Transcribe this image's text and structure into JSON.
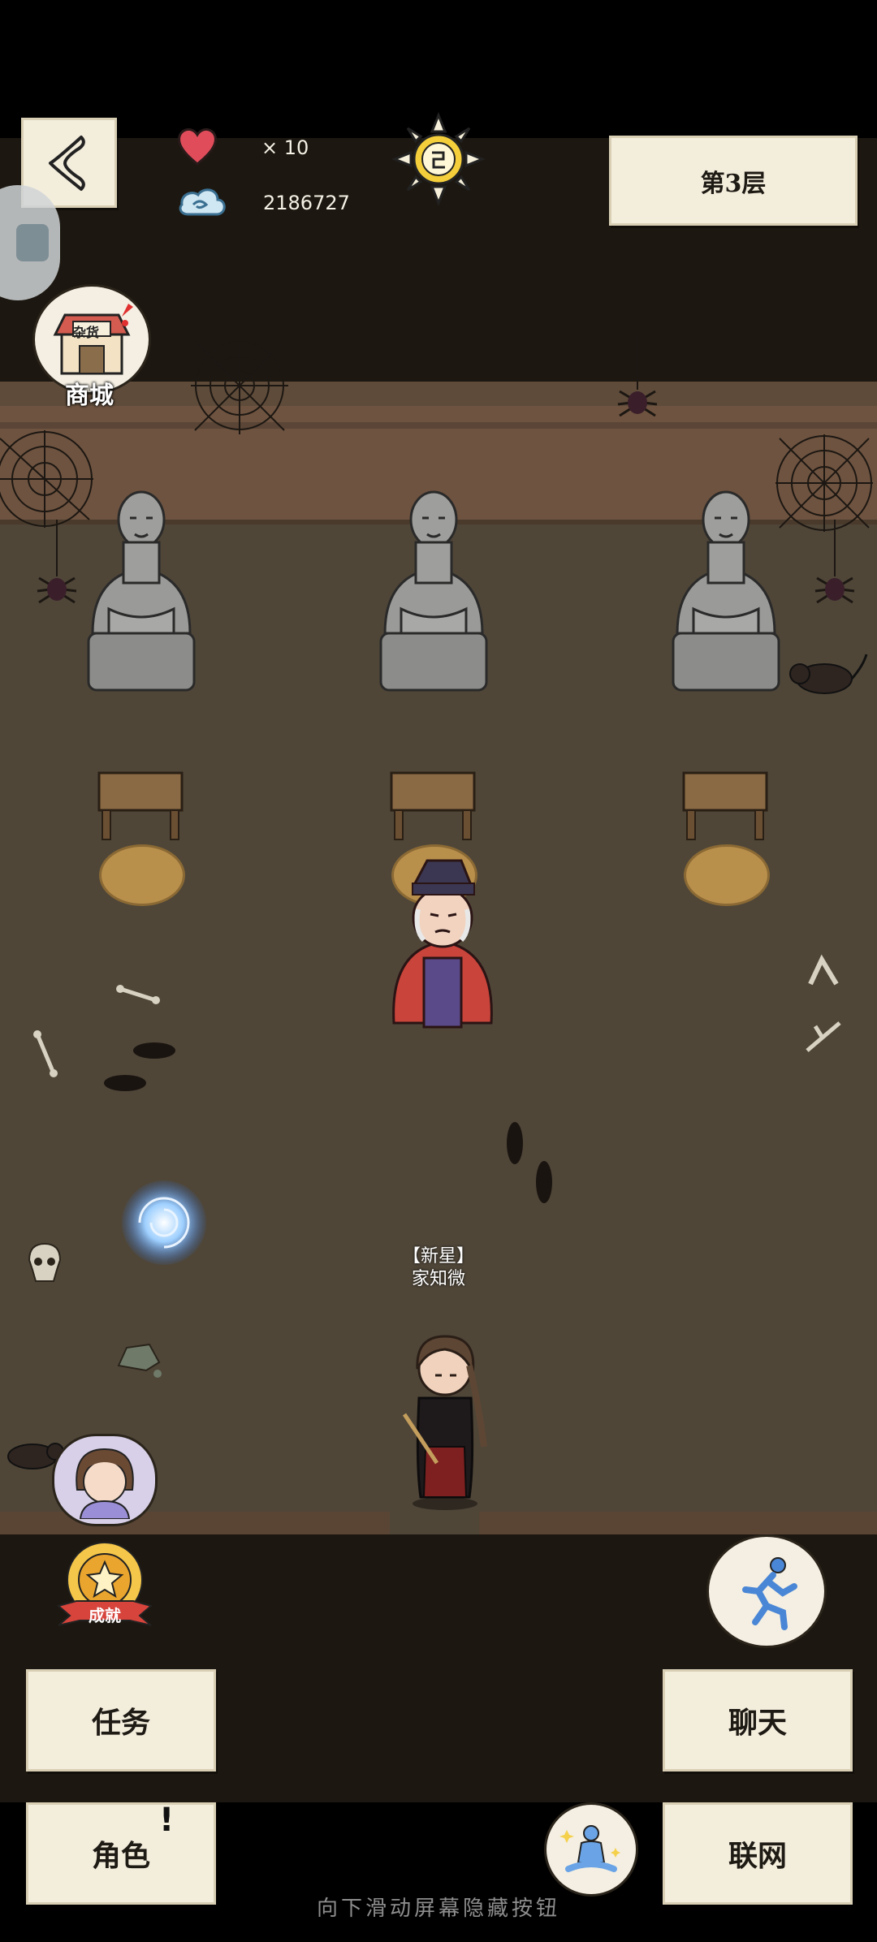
{
  "hud": {
    "lives": "× 10",
    "spirit": "2186727",
    "floor_label": "第3层"
  },
  "side": {
    "shop_label": "商城",
    "shop_sign": "杂货",
    "achievement_label": "成就"
  },
  "npc": {
    "player_title": "【新星】",
    "player_name": "家知微"
  },
  "buttons": {
    "task": "任务",
    "chat": "聊天",
    "role": "角色",
    "network": "联网"
  },
  "hint": "向下滑动屏幕隐藏按钮",
  "colors": {
    "floor": "#4f4638",
    "wall": "#6e5340",
    "paper": "#f3eddc",
    "heart": "#e04c5a",
    "portal": "#7fb8ff"
  }
}
